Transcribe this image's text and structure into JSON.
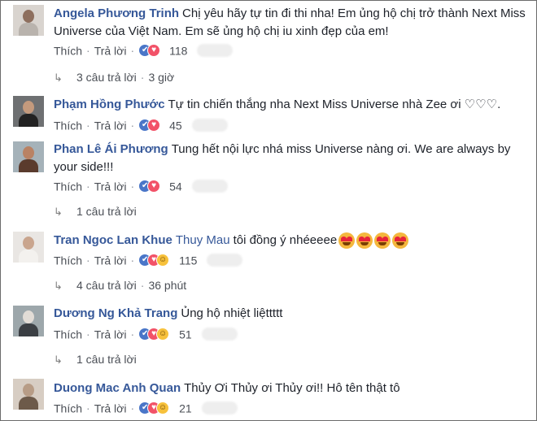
{
  "comments": [
    {
      "author": "Angela Phương Trinh",
      "mention": "",
      "text": "Chị yêu hãy tự tin đi thi nha! Em ủng hộ chị trở thành Next Miss Universe của Việt Nam. Em sẽ ủng hộ chị iu xinh đẹp của em!",
      "like_label": "Thích",
      "reply_label": "Trả lời",
      "reactions": [
        "like",
        "love"
      ],
      "count": "118",
      "replies": {
        "label": "3 câu trả lời",
        "time": "3 giờ"
      },
      "avatar_colors": [
        "#d9d4cf",
        "#8e6f5e",
        "#b9b3ad"
      ]
    },
    {
      "author": "Phạm Hồng Phước",
      "mention": "",
      "text": "Tự tin chiến thắng nha Next Miss Universe nhà Zee ơi ♡♡♡.",
      "like_label": "Thích",
      "reply_label": "Trả lời",
      "reactions": [
        "like",
        "love"
      ],
      "count": "45",
      "replies": null,
      "avatar_colors": [
        "#6e7072",
        "#c49a7d",
        "#222222"
      ]
    },
    {
      "author": "Phan Lê Ái Phương",
      "mention": "",
      "text": "Tung hết nội lực nhá miss Universe nàng ơi. We are always by your side!!!",
      "like_label": "Thích",
      "reply_label": "Trả lời",
      "reactions": [
        "like",
        "love"
      ],
      "count": "54",
      "replies": {
        "label": "1 câu trả lời",
        "time": ""
      },
      "avatar_colors": [
        "#a5b2b9",
        "#b98264",
        "#5a3b2d"
      ]
    },
    {
      "author": "Tran Ngoc Lan Khue",
      "mention": "Thuy Mau",
      "text": "tôi đồng ý nhéeeee",
      "emoji_count": 4,
      "like_label": "Thích",
      "reply_label": "Trả lời",
      "reactions": [
        "like",
        "love",
        "haha"
      ],
      "count": "115",
      "replies": {
        "label": "4 câu trả lời",
        "time": "36 phút"
      },
      "avatar_colors": [
        "#e9e6e3",
        "#c9a58e",
        "#f3f1ee"
      ]
    },
    {
      "author": "Dương Ng Khả Trang",
      "mention": "",
      "text": "Ủng hộ nhiệt liệttttt",
      "like_label": "Thích",
      "reply_label": "Trả lời",
      "reactions": [
        "like",
        "love",
        "haha"
      ],
      "count": "51",
      "replies": {
        "label": "1 câu trả lời",
        "time": ""
      },
      "avatar_colors": [
        "#9da7ab",
        "#e2dcd6",
        "#3b3f44"
      ]
    },
    {
      "author": "Duong Mac Anh Quan",
      "mention": "",
      "text": "Thủy Ơi Thủy ơi Thủy ơi!! Hô tên thật tô",
      "like_label": "Thích",
      "reply_label": "Trả lời",
      "reactions": [
        "like",
        "love",
        "haha"
      ],
      "count": "21",
      "replies": null,
      "avatar_colors": [
        "#d7cdc3",
        "#b79c86",
        "#6d5a4a"
      ]
    }
  ],
  "colors": {
    "author": "#365899",
    "meta": "#4b4f56",
    "like": "#4a76c8",
    "love": "#f25268",
    "haha": "#f7c13b"
  },
  "icons": {
    "reply": "reply-arrow-icon",
    "like": "like-reaction-icon",
    "love": "love-reaction-icon",
    "haha": "haha-reaction-icon",
    "emoji": "heart-eyes-emoji-icon"
  }
}
